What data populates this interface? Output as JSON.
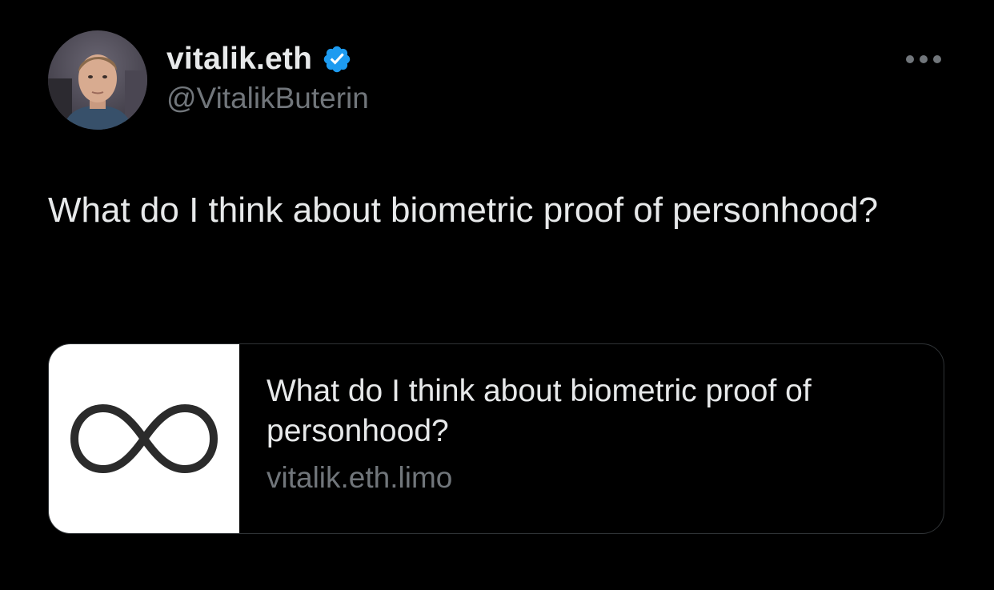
{
  "author": {
    "display_name": "vitalik.eth",
    "handle": "@VitalikButerin",
    "verified": true,
    "verified_color": "#1d9bf0",
    "avatar_icon": "profile-photo"
  },
  "more_menu": {
    "icon": "more-horizontal-icon"
  },
  "tweet": {
    "text": "What do I think about biometric proof of personhood?"
  },
  "link_card": {
    "title": "What do I think about biometric proof of personhood?",
    "domain": "vitalik.eth.limo",
    "thumbnail_icon": "infinity-icon"
  },
  "colors": {
    "background": "#000000",
    "primary_text": "#e7e9ea",
    "secondary_text": "#71767b",
    "card_border": "#2f3336"
  }
}
